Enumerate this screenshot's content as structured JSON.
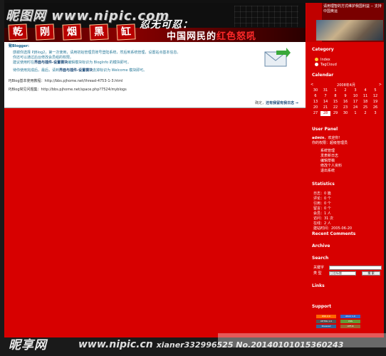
{
  "watermark": {
    "top": "昵图网 www.nipic.com",
    "bottom_brand": "昵享网",
    "bottom_url": "www.nipic.cn",
    "bottom_tail": "xianer332996525 No.20140101015360243"
  },
  "banner": {
    "seals": [
      "乾",
      "刚",
      "烟",
      "黑",
      "缸"
    ],
    "title_line1": "忍无可忍：",
    "title_line2_prefix": "中国网民的",
    "title_line2_highlight": "红色怒吼"
  },
  "photo_panel": {
    "caption": "请用理智的方式维护我国利益 -- 支持中国奥运"
  },
  "main": {
    "greeting": "致Blogger:",
    "para1": "感谢你选择 PJBlog2，第一次使用，请用初始管理员账号登陆系统，然后到系统管理，设置站点基本信息。",
    "para2": "你还可以通过后台修改会员组的权限。",
    "para3_prefix": "建议使用时在",
    "para3_link": "界面与插件-设置模块",
    "para3_suffix": "编辑模块标识为 BlogInfo 的模块即可。",
    "para4_prefix": "待你使用完成后，最后，请到",
    "para4_link": "界面与插件-设置模块",
    "para4_suffix": "去掉标识为 Welcome 模块即可。",
    "link1": "PJBlog基本使用教程：http://bbs.pjhome.net/thread-4753-1-3.html",
    "link2": "PJBlog常见问题集：http://bbs.pjhome.net/space.php?7524/myblogs",
    "footer_prefix": "确定，",
    "footer_link": "还有我留有我日志 →"
  },
  "sidebar": {
    "category_title": "Category",
    "category_items": [
      "Index",
      "TagCloud"
    ],
    "calendar_title": "Calendar",
    "calendar_month": "2008年4月",
    "calendar_prev": "<",
    "calendar_next": ">",
    "calendar_days": [
      "30",
      "31",
      "1",
      "2",
      "3",
      "4",
      "5",
      "6",
      "7",
      "8",
      "9",
      "10",
      "11",
      "12",
      "13",
      "14",
      "15",
      "16",
      "17",
      "18",
      "19",
      "20",
      "21",
      "22",
      "23",
      "24",
      "25",
      "26",
      "27",
      "28",
      "29",
      "30",
      "1",
      "2",
      "3"
    ],
    "calendar_today": "28",
    "user_panel_title": "User Panel",
    "user_name": "admin",
    "user_welcome": "，欢迎你！",
    "user_role": "你的权限：超级管理员",
    "user_links": [
      "系统管理",
      "发表新日志",
      "编辑草稿",
      "修改个人资料",
      "退出系统"
    ],
    "statistics_title": "Statistics",
    "stats": [
      "日志：0 篇",
      "评论：0 个",
      "引用：0 个",
      "留言：0 个",
      "会员：1 人",
      "访问：31 次",
      "在线：2 人",
      "建站时间：2005-06-20"
    ],
    "recent_comments_title": "Recent Comments",
    "archive_title": "Archive",
    "search_title": "Search",
    "search_keyword_label": "关键字",
    "search_type_label": "类 型",
    "search_type_value": "日志标题",
    "search_button": "搜 索",
    "links_title": "Links",
    "support_title": "Support",
    "support_badges": [
      "RSS 2.0",
      "Atom 1.0",
      "XHTML 1.0",
      "CSS",
      "Powered",
      "UTF-8"
    ]
  },
  "colors": {
    "page_red": "#d70000",
    "banner_black": "#0f0f0f",
    "text_blue": "#2a7a9a",
    "link_blue": "#1a4a7a"
  }
}
